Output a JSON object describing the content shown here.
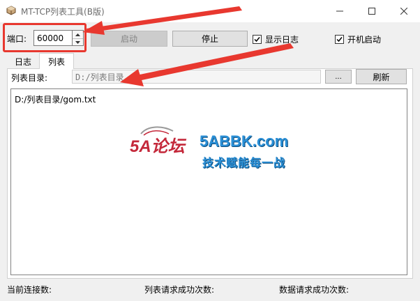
{
  "window": {
    "title": "MT-TCP列表工具(B版)",
    "icon": "cube-app-icon",
    "controls": [
      "minimize-icon",
      "maximize-icon",
      "close-icon"
    ]
  },
  "toolbar": {
    "port_label": "端口:",
    "port_value": "60000",
    "start_label": "启动",
    "stop_label": "停止",
    "show_log_label": "显示日志",
    "show_log_checked": true,
    "autostart_label": "开机启动",
    "autostart_checked": true
  },
  "tabs": [
    {
      "label": "日志",
      "active": false
    },
    {
      "label": "列表",
      "active": true
    }
  ],
  "list_panel": {
    "dir_label": "列表目录:",
    "dir_value": "D:/列表目录",
    "browse_label": "...",
    "refresh_label": "刷新",
    "items": [
      "D:/列表目录/gom.txt"
    ]
  },
  "watermark": {
    "logo_text": "5A论坛",
    "site_text": "5ABBK.com",
    "slogan_text": "技术赋能每一战"
  },
  "status_bar": {
    "connections_label": "当前连接数:",
    "list_requests_label": "列表请求成功次数:",
    "data_requests_label": "数据请求成功次数:"
  },
  "colors": {
    "annotation_red": "#e8382f",
    "watermark_blue": "#2a8fd6",
    "watermark_red": "#c4283a"
  }
}
